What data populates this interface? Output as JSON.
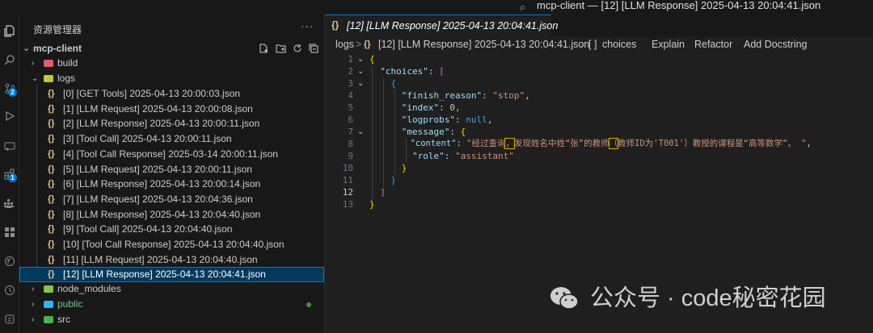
{
  "window": {
    "title": "mcp-client — [12] [LLM Response] 2025-04-13 20:04:41.json"
  },
  "activity_bar": {
    "items": [
      {
        "icon": "files-icon"
      },
      {
        "icon": "search-icon"
      },
      {
        "icon": "source-control-icon",
        "badge": "2"
      },
      {
        "icon": "run-debug-icon"
      },
      {
        "icon": "remote-explorer-icon"
      },
      {
        "icon": "extensions-icon",
        "badge": "1"
      },
      {
        "icon": "docker-icon"
      },
      {
        "icon": "grid-icon"
      },
      {
        "icon": "git-graph-icon"
      },
      {
        "icon": "timeline-icon"
      },
      {
        "icon": "database-icon"
      }
    ]
  },
  "explorer": {
    "title": "资源管理器",
    "more": "···",
    "root": "mcp-client",
    "folders_top": [
      {
        "label": "build",
        "expanded": false,
        "color": "#e05d6f"
      },
      {
        "label": "logs",
        "expanded": true,
        "color": "#c0ca33"
      }
    ],
    "log_files": [
      "[0] [GET Tools] 2025-04-13 20:00:03.json",
      "[1] [LLM Request] 2025-04-13 20:00:08.json",
      "[2] [LLM Response] 2025-04-13 20:00:11.json",
      "[3] [Tool Call] 2025-04-13 20:00:11.json",
      "[4] [Tool Call Response] 2025-03-14 20:00:11.json",
      "[5] [LLM Request] 2025-04-13 20:00:11.json",
      "[6] [LLM Response] 2025-04-13 20:00:14.json",
      "[7] [LLM Request] 2025-04-13 20:04:36.json",
      "[8] [LLM Response] 2025-04-13 20:04:40.json",
      "[9] [Tool Call] 2025-04-13 20:04:40.json",
      "[10] [Tool Call Response] 2025-04-13 20:04:40.json",
      "[11] [LLM Request] 2025-04-13 20:04:40.json",
      "[12] [LLM Response] 2025-04-13 20:04:41.json"
    ],
    "selected_index": 12,
    "folders_bottom": [
      {
        "label": "node_modules",
        "color": "#8bc34a"
      },
      {
        "label": "public",
        "color": "#29b6f6",
        "label_color": "#73c991"
      },
      {
        "label": "src",
        "color": "#4caf50"
      }
    ],
    "json_icon": "{}"
  },
  "editor": {
    "tab_label": "[12] [LLM Response] 2025-04-13 20:04:41.json",
    "breadcrumb": {
      "folder": "logs",
      "file": "[12] [LLM Response] 2025-04-13 20:04:41.json",
      "symbol": "choices",
      "symbol_icon": "[ ]",
      "separator": ">",
      "code_lens": [
        "Explain",
        "Refactor",
        "Add Docstring"
      ]
    },
    "current_line": 12,
    "lines": [
      {
        "n": "1"
      },
      {
        "n": "2"
      },
      {
        "n": "3"
      },
      {
        "n": "4"
      },
      {
        "n": "5"
      },
      {
        "n": "6"
      },
      {
        "n": "7"
      },
      {
        "n": "8"
      },
      {
        "n": "9"
      },
      {
        "n": "10"
      },
      {
        "n": "11"
      },
      {
        "n": "12"
      },
      {
        "n": "13"
      }
    ],
    "json": {
      "finish_reason_key": "\"finish_reason\"",
      "finish_reason_val": "\"stop\"",
      "index_key": "\"index\"",
      "index_val": "0",
      "logprobs_key": "\"logprobs\"",
      "logprobs_val": "null",
      "choices_key": "\"choices\"",
      "message_key": "\"message\"",
      "content_key": "\"content\"",
      "content_part1": "\"经过查询",
      "content_comma1": "，",
      "content_part2": "发现姓名中姓“张”的教师",
      "content_paren": "（",
      "content_part3": "教师ID为'T001'）教授的课程是“高等数学”。 \"",
      "role_key": "\"role\"",
      "role_val": "\"assistant\""
    }
  },
  "watermark": {
    "text": "公众号 · code秘密花园"
  }
}
